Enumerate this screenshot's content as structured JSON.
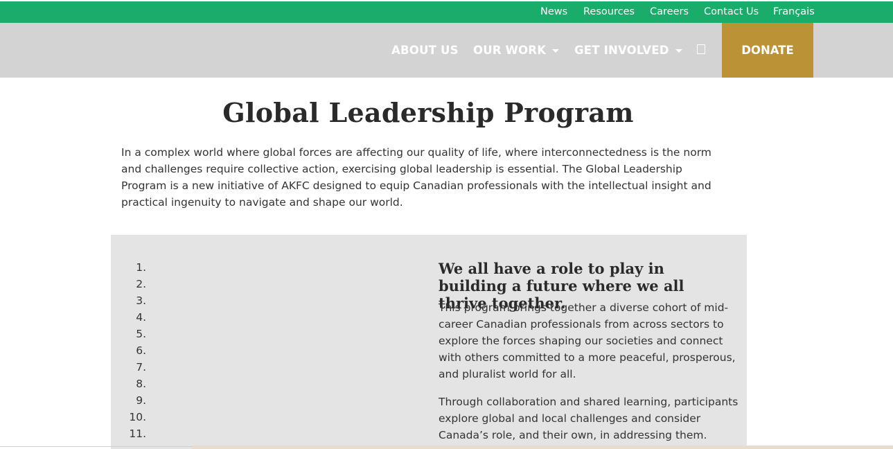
{
  "utility_nav": {
    "items": [
      "News",
      "Resources",
      "Careers",
      "Contact Us",
      "Français"
    ]
  },
  "main_nav": {
    "about": "ABOUT US",
    "work": "OUR WORK",
    "involved": "GET INVOLVED",
    "donate": "DONATE"
  },
  "page": {
    "title": "Global Leadership Program",
    "intro": "In a complex world where global forces are affecting our quality of life, where interconnectedness is the norm and challenges require collective action, exercising global leadership is essential. The Global Leadership Program is a new initiative of AKFC designed to equip Canadian professionals with the intellectual insight and practical ingenuity to navigate and shape our world."
  },
  "feature": {
    "list_numbers": [
      "1.",
      "2.",
      "3.",
      "4.",
      "5.",
      "6.",
      "7.",
      "8.",
      "9.",
      "10.",
      "11."
    ],
    "heading": "We all have a role to play in building a future where we all thrive together.",
    "paragraph_1": "This program brings together a diverse cohort of mid-career Canadian professionals from across sectors to explore the forces shaping our societies and connect with others committed to a more peaceful, prosperous, and pluralist world for all.",
    "paragraph_2": "Through collaboration and shared learning, participants explore global and local challenges and consider Canada’s role, and their own, in addressing them."
  },
  "colors": {
    "top_bar": "#19ac6b",
    "nav_bg": "#d3d3d3",
    "donate_bg": "#bb9336",
    "feature_bg": "#e4e4e4"
  },
  "icons": {
    "search": "search-icon"
  }
}
